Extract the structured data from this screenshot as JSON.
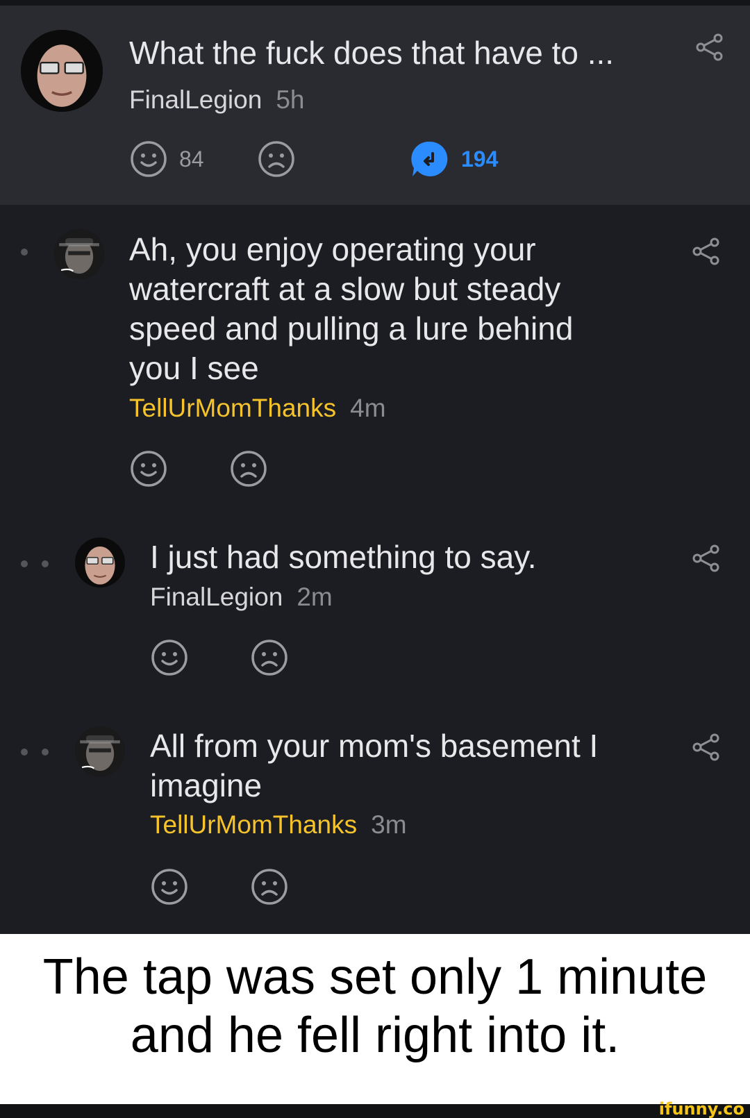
{
  "parent_comment": {
    "text": "What the fuck does that have to ...",
    "username": "FinalLegion",
    "time": "5h",
    "smile_count": "84",
    "reply_count": "194"
  },
  "replies": [
    {
      "text_lines": [
        "Ah, you enjoy operating your",
        "watercraft at a slow but steady",
        "speed and pulling a lure behind",
        "you I see"
      ],
      "username": "TellUrMomThanks",
      "time": "4m"
    },
    {
      "text_lines": [
        "I just had something to say."
      ],
      "username": "FinalLegion",
      "time": "2m"
    },
    {
      "text_lines": [
        "All from your mom's basement I",
        "imagine"
      ],
      "username": "TellUrMomThanks",
      "time": "3m"
    }
  ],
  "caption_lines": [
    "The tap was set only 1 minute",
    "and he fell right into it."
  ],
  "watermark": "ifunny.co",
  "colors": {
    "background": "#1c1d22",
    "parent_background": "#2a2b31",
    "username_highlight": "#f6c32b",
    "reply_accent": "#2b8cff"
  }
}
